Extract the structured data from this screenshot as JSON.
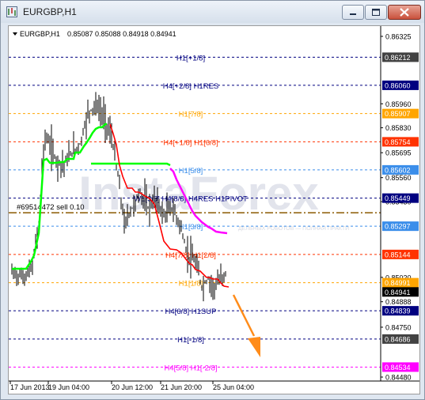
{
  "window": {
    "title": "EURGBP,H1"
  },
  "chart_header": {
    "symbol": "EURGBP,H1",
    "values": "0.85087 0.85088 0.84918 0.84941"
  },
  "watermark": "InstaForex",
  "watermark_sub": "ДЕЛЬНЫХ РОБОТОВ — ПОЛНАЯ ПРАКТИ",
  "colors": {
    "background": "#ffffff",
    "axis_label_bg_default": "#2b2b2b",
    "navy": "#000080",
    "green_line": "#00ff00",
    "red_line": "#ff0000",
    "magenta_line": "#ff00ff",
    "orange_arrow": "#ff8c1a"
  },
  "price_axis": {
    "plain_ticks": [
      "0.86325",
      "0.85960",
      "0.85830",
      "0.85695",
      "0.85560",
      "0.85430",
      "0.85020",
      "0.84888",
      "0.84750",
      "0.84480"
    ]
  },
  "levels": [
    {
      "name": "H1[+1/8]",
      "price": "0.86212",
      "line_color": "#000080",
      "text_color": "#000080",
      "label_bg": "#424242",
      "text_x": 230
    },
    {
      "name": "H4[+2/8] H1RES",
      "price": "0.86060",
      "line_color": "#000080",
      "text_color": "#000080",
      "label_bg": "#000080",
      "text_x": 230
    },
    {
      "name": "H1[7/8]",
      "price": "0.85907",
      "line_color": "#ffa500",
      "text_color": "#ffa500",
      "label_bg": "#ffa500",
      "text_x": 230
    },
    {
      "name": "H4[+1/8] H1[6/8]",
      "price": "0.85754",
      "line_color": "#ff3300",
      "text_color": "#ff3300",
      "label_bg": "#ff3300",
      "text_x": 230
    },
    {
      "name": "H1[5/8]",
      "price": "0.85602",
      "line_color": "#3b8eea",
      "text_color": "#3b8eea",
      "label_bg": "#3b8eea",
      "text_x": 230
    },
    {
      "name": "W1[3/8] H4[8/8] H4RES H1PIVOT",
      "price": "0.85449",
      "line_color": "#000080",
      "text_color": "#000080",
      "label_bg": "#000080",
      "text_x": 230
    },
    {
      "name": "H1[3/8]",
      "price": "0.85297",
      "line_color": "#3b8eea",
      "text_color": "#3b8eea",
      "label_bg": "#3b8eea",
      "text_x": 230
    },
    {
      "name": "H4[7/8] H1[2/8]",
      "price": "0.85144",
      "line_color": "#ff3300",
      "text_color": "#ff3300",
      "label_bg": "#ff3300",
      "text_x": 230
    },
    {
      "name": "H1[1/8]",
      "price": "0.84991",
      "line_color": "#ffa500",
      "text_color": "#ffa500",
      "label_bg": "#ffa500",
      "text_x": 230
    },
    {
      "name": "H4[6/8] H1SUP",
      "price": "0.84839",
      "line_color": "#000080",
      "text_color": "#000080",
      "label_bg": "#000080",
      "text_x": 230
    },
    {
      "name": "H1[-1/8]",
      "price": "0.84686",
      "line_color": "#000080",
      "text_color": "#000080",
      "label_bg": "#424242",
      "text_x": 230
    },
    {
      "name": "H4[5/8] H1[-2/8]",
      "price": "0.84534",
      "line_color": "#ff00ff",
      "text_color": "#ff00ff",
      "label_bg": "#ff00ff",
      "text_x": 230
    }
  ],
  "current_price": "0.84941",
  "order_line": {
    "label": "#69514472 sell 0.10",
    "price": "0.85370"
  },
  "time_axis": [
    "17 Jun 2013",
    "19 Jun 04:00",
    "20 Jun 12:00",
    "21 Jun 20:00",
    "25 Jun 04:00"
  ]
}
